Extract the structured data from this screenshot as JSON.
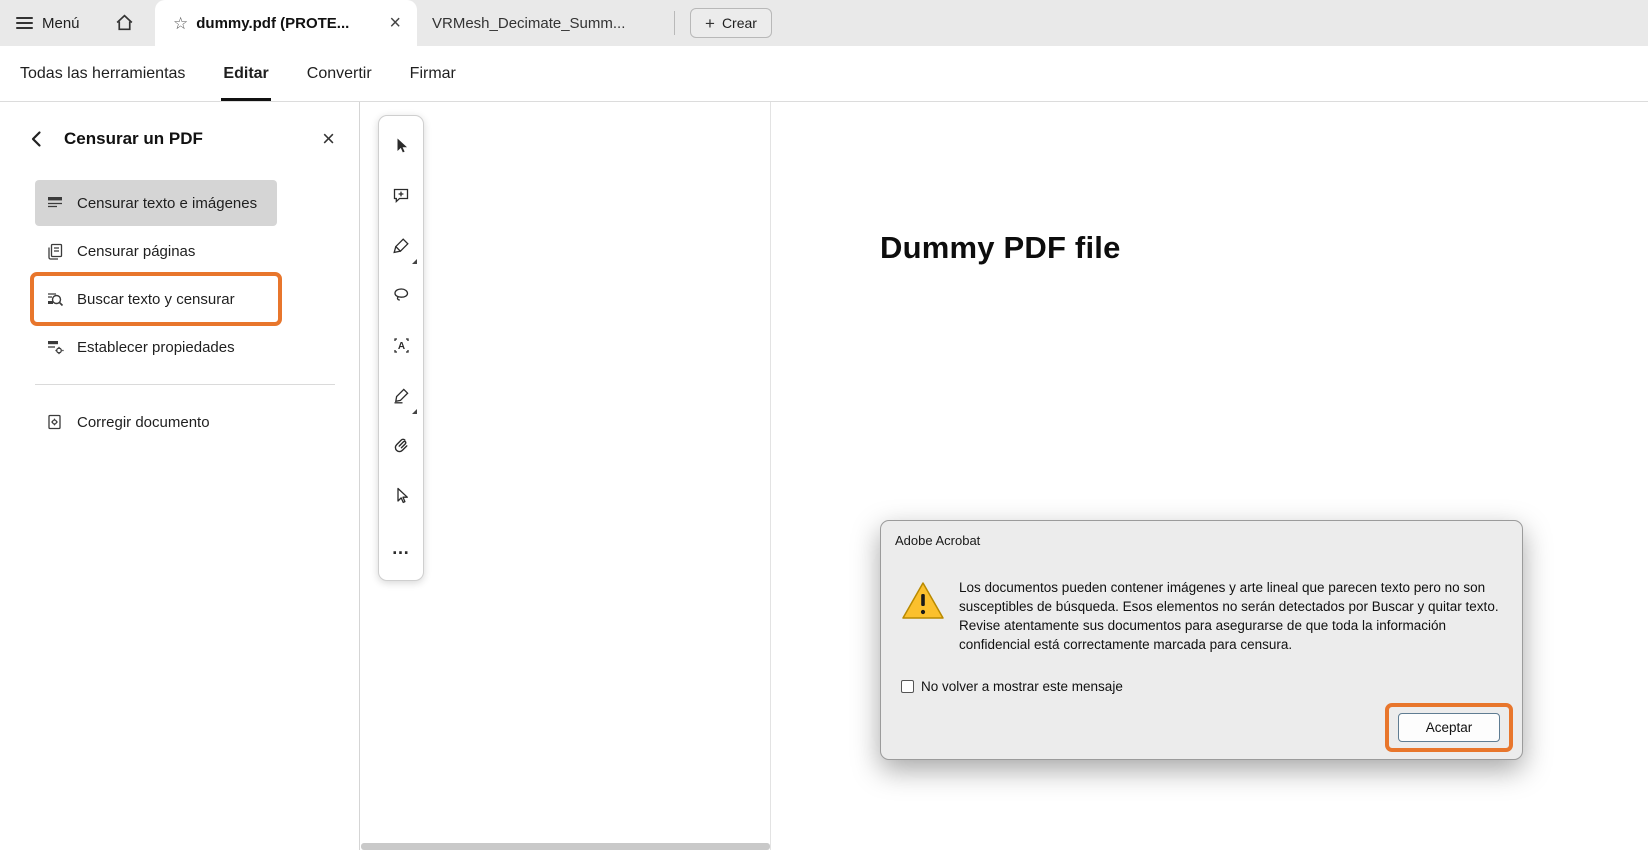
{
  "colors": {
    "accent_orange": "#E8762C",
    "selected_item_bg": "#d5d5d5"
  },
  "icons": {
    "star": "☆",
    "close": "×",
    "plus": "+",
    "more": "…"
  },
  "top_bar": {
    "menu_label": "Menú",
    "tabs": [
      {
        "label": "dummy.pdf (PROTE...",
        "active": true
      },
      {
        "label": "VRMesh_Decimate_Summ...",
        "active": false
      }
    ],
    "create_label": "Crear"
  },
  "nav": {
    "items": [
      {
        "label": "Todas las herramientas",
        "active": false
      },
      {
        "label": "Editar",
        "active": true
      },
      {
        "label": "Convertir",
        "active": false
      },
      {
        "label": "Firmar",
        "active": false
      }
    ]
  },
  "sidebar": {
    "title": "Censurar un PDF",
    "items": [
      {
        "label": "Censurar texto e imágenes",
        "selected": true,
        "annotated": false
      },
      {
        "label": "Censurar páginas",
        "selected": false,
        "annotated": false
      },
      {
        "label": "Buscar texto y censurar",
        "selected": false,
        "annotated": true
      },
      {
        "label": "Establecer propiedades",
        "selected": false,
        "annotated": false
      },
      {
        "label": "Corregir documento",
        "selected": false,
        "annotated": false
      }
    ]
  },
  "document": {
    "title": "Dummy PDF file"
  },
  "dialog": {
    "title": "Adobe Acrobat",
    "message": "Los documentos pueden contener imágenes y arte lineal que parecen texto pero no son susceptibles de búsqueda. Esos elementos no serán detectados por Buscar y quitar texto. Revise atentamente sus documentos para asegurarse de que toda la información confidencial está correctamente marcada para censura.",
    "checkbox_label": "No volver a mostrar este mensaje",
    "accept_label": "Aceptar"
  }
}
